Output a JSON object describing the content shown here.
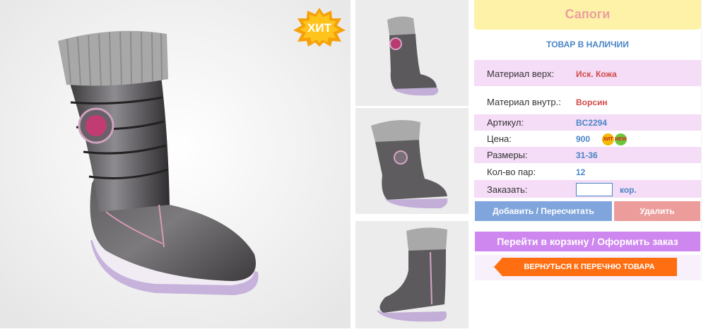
{
  "product": {
    "title": "Сапоги",
    "availability": "ТОВАР В НАЛИЧИИ",
    "hit_badge": "ХИТ",
    "specs": {
      "material_top_label": "Материал верх:",
      "material_top_value": "Иск. Кожа",
      "material_inner_label": "Материал внутр.:",
      "material_inner_value": "Ворсин",
      "article_label": "Артикул:",
      "article_value": "BC2294",
      "price_label": "Цена:",
      "price_value": "900",
      "price_badge_hit": "ХИТ",
      "price_badge_new": "NEW",
      "sizes_label": "Размеры:",
      "sizes_value": "31-36",
      "pairs_label": "Кол-во пар:",
      "pairs_value": "12",
      "order_label": "Заказать:",
      "order_value": "",
      "order_unit": "кор."
    },
    "buttons": {
      "add": "Добавить / Пересчитать",
      "delete": "Удалить",
      "cart": "Перейти в корзину / Оформить заказ",
      "back": "ВЕРНУТЬСЯ К ПЕРЕЧНЮ ТОВАРА"
    }
  },
  "colors": {
    "title_bg": "#fdf2a8",
    "title_text": "#ec9f9f",
    "row_pink": "#f5dcf7",
    "accent_blue": "#4a86c5",
    "value_red": "#d24a4a",
    "add_button": "#7fa5dc",
    "delete_button": "#ed9c9c",
    "cart_button": "#cf87f0",
    "back_button": "#ff6f12"
  },
  "icons": [
    "boot-photo",
    "hit-star-badge",
    "new-badge"
  ]
}
